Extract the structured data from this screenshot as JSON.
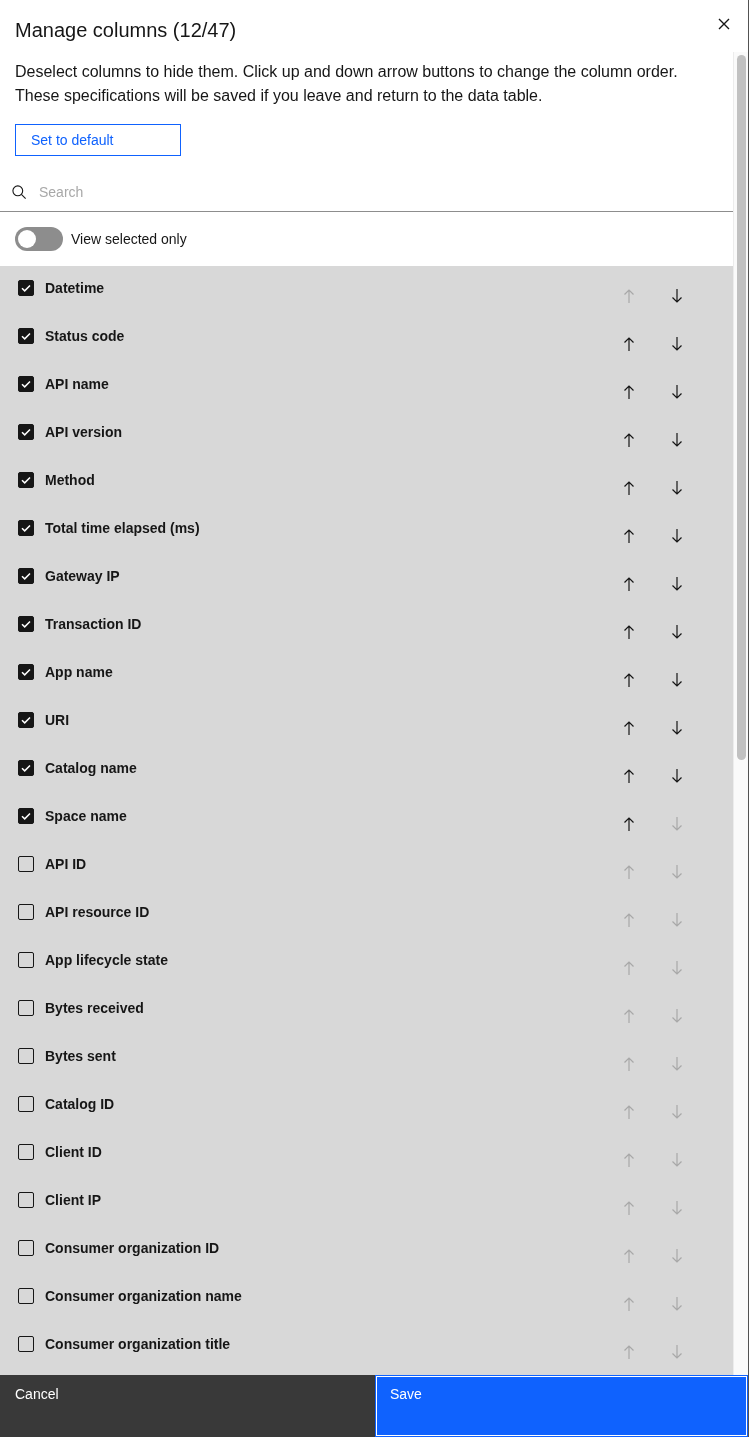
{
  "dialog": {
    "title": "Manage columns (12/47)",
    "description": [
      "Deselect columns to hide them. Click up and down arrow buttons to change the column order.",
      "These specifications will be saved if you leave and return to the data table."
    ],
    "default_button": "Set to default"
  },
  "search": {
    "placeholder": "Search"
  },
  "view_selected_only": {
    "label": "View selected only",
    "on": false
  },
  "columns": [
    {
      "name": "Datetime",
      "checked": true,
      "up_disabled": true,
      "down_disabled": false
    },
    {
      "name": "Status code",
      "checked": true,
      "up_disabled": false,
      "down_disabled": false
    },
    {
      "name": "API name",
      "checked": true,
      "up_disabled": false,
      "down_disabled": false
    },
    {
      "name": "API version",
      "checked": true,
      "up_disabled": false,
      "down_disabled": false
    },
    {
      "name": "Method",
      "checked": true,
      "up_disabled": false,
      "down_disabled": false
    },
    {
      "name": "Total time elapsed (ms)",
      "checked": true,
      "up_disabled": false,
      "down_disabled": false
    },
    {
      "name": "Gateway IP",
      "checked": true,
      "up_disabled": false,
      "down_disabled": false
    },
    {
      "name": "Transaction ID",
      "checked": true,
      "up_disabled": false,
      "down_disabled": false
    },
    {
      "name": "App name",
      "checked": true,
      "up_disabled": false,
      "down_disabled": false
    },
    {
      "name": "URI",
      "checked": true,
      "up_disabled": false,
      "down_disabled": false
    },
    {
      "name": "Catalog name",
      "checked": true,
      "up_disabled": false,
      "down_disabled": false
    },
    {
      "name": "Space name",
      "checked": true,
      "up_disabled": false,
      "down_disabled": true
    },
    {
      "name": "API ID",
      "checked": false,
      "up_disabled": true,
      "down_disabled": true
    },
    {
      "name": "API resource ID",
      "checked": false,
      "up_disabled": true,
      "down_disabled": true
    },
    {
      "name": "App lifecycle state",
      "checked": false,
      "up_disabled": true,
      "down_disabled": true
    },
    {
      "name": "Bytes received",
      "checked": false,
      "up_disabled": true,
      "down_disabled": true
    },
    {
      "name": "Bytes sent",
      "checked": false,
      "up_disabled": true,
      "down_disabled": true
    },
    {
      "name": "Catalog ID",
      "checked": false,
      "up_disabled": true,
      "down_disabled": true
    },
    {
      "name": "Client ID",
      "checked": false,
      "up_disabled": true,
      "down_disabled": true
    },
    {
      "name": "Client IP",
      "checked": false,
      "up_disabled": true,
      "down_disabled": true
    },
    {
      "name": "Consumer organization ID",
      "checked": false,
      "up_disabled": true,
      "down_disabled": true
    },
    {
      "name": "Consumer organization name",
      "checked": false,
      "up_disabled": true,
      "down_disabled": true
    },
    {
      "name": "Consumer organization title",
      "checked": false,
      "up_disabled": true,
      "down_disabled": true
    }
  ],
  "footer": {
    "cancel": "Cancel",
    "save": {
      "label": "Save",
      "focused": true
    }
  }
}
